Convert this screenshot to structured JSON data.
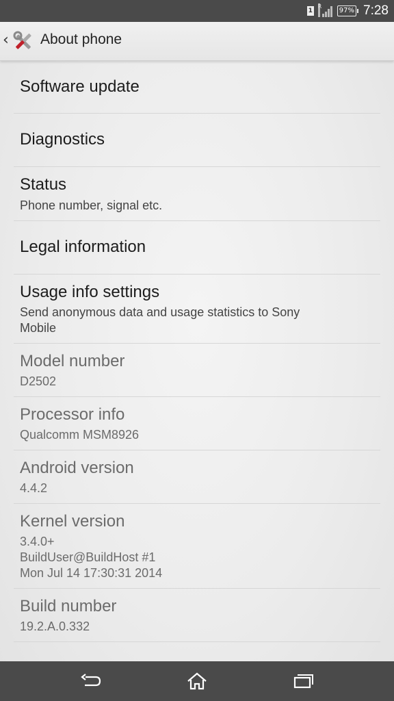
{
  "status_bar": {
    "sim_label": "1",
    "roaming_label": "R",
    "battery": "97%",
    "time": "7:28"
  },
  "action_bar": {
    "title": "About phone"
  },
  "items": [
    {
      "title": "Software update"
    },
    {
      "title": "Diagnostics"
    },
    {
      "title": "Status",
      "subtitle": "Phone number, signal etc."
    },
    {
      "title": "Legal information"
    },
    {
      "title": "Usage info settings",
      "subtitle": "Send anonymous data and usage statistics to Sony\nMobile"
    },
    {
      "title": "Model number",
      "subtitle": "D2502"
    },
    {
      "title": "Processor info",
      "subtitle": "Qualcomm MSM8926"
    },
    {
      "title": "Android version",
      "subtitle": "4.4.2"
    },
    {
      "title": "Kernel version",
      "subtitle": "3.4.0+\nBuildUser@BuildHost #1\nMon Jul 14 17:30:31 2014"
    },
    {
      "title": "Build number",
      "subtitle": "19.2.A.0.332"
    }
  ],
  "nav_bar": {
    "icons": [
      "back-icon",
      "home-icon",
      "recent-apps-icon"
    ]
  }
}
